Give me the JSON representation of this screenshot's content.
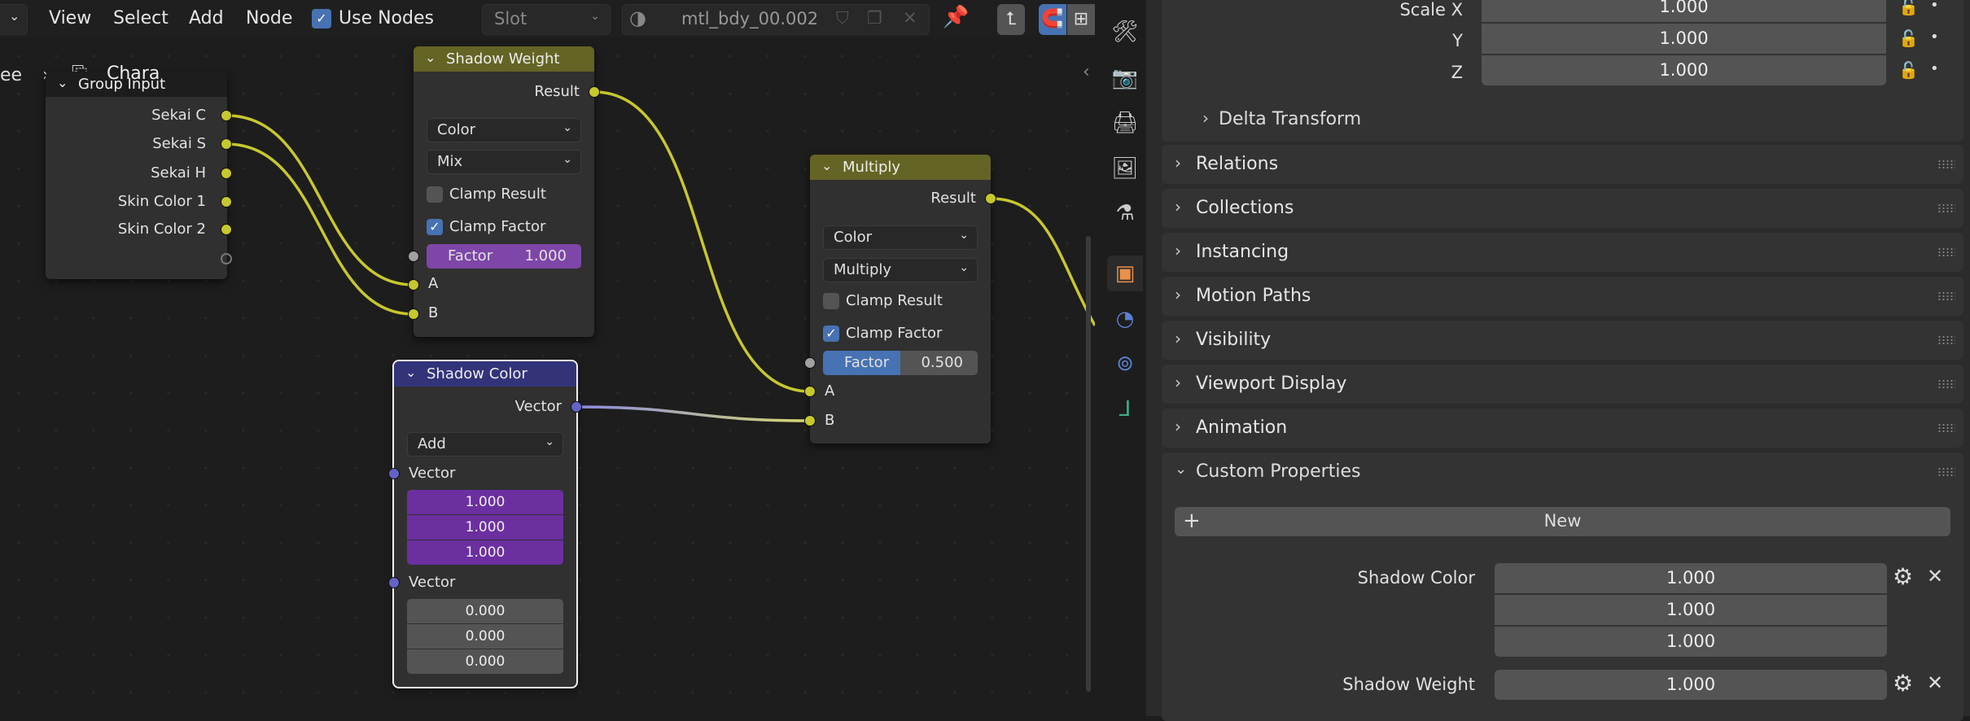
{
  "header": {
    "menus": [
      "View",
      "Select",
      "Add",
      "Node"
    ],
    "use_nodes_label": "Use Nodes",
    "use_nodes_checked": true,
    "slot_placeholder": "Slot",
    "material_name": "mtl_bdy_00.002"
  },
  "breadcrumb": {
    "prev": "ee",
    "item": "Chara"
  },
  "nodes": {
    "group_input": {
      "title": "Group Input",
      "outputs": [
        "Sekai C",
        "Sekai S",
        "Sekai H",
        "Skin Color 1",
        "Skin Color 2"
      ]
    },
    "shadow_weight": {
      "title": "Shadow Weight",
      "output": "Result",
      "data_type": "Color",
      "blend": "Mix",
      "clamp_result": "Clamp Result",
      "clamp_factor": "Clamp Factor",
      "factor_label": "Factor",
      "factor_value": "1.000",
      "inputs": [
        "A",
        "B"
      ],
      "color": "#646425"
    },
    "multiply": {
      "title": "Multiply",
      "output": "Result",
      "data_type": "Color",
      "blend": "Multiply",
      "clamp_result": "Clamp Result",
      "clamp_factor": "Clamp Factor",
      "factor_label": "Factor",
      "factor_value": "0.500",
      "factor_fraction": 0.5,
      "inputs": [
        "A",
        "B"
      ],
      "color": "#646425"
    },
    "shadow_color": {
      "title": "Shadow Color",
      "output": "Vector",
      "operation": "Add",
      "input1": "Vector",
      "values1": [
        "1.000",
        "1.000",
        "1.000"
      ],
      "input2": "Vector",
      "values2": [
        "0.000",
        "0.000",
        "0.000"
      ],
      "color": "#33337a"
    }
  },
  "properties": {
    "scale": [
      {
        "label": "Scale X",
        "value": "1.000"
      },
      {
        "label": "Y",
        "value": "1.000"
      },
      {
        "label": "Z",
        "value": "1.000"
      }
    ],
    "delta_transform": "Delta Transform",
    "panels": [
      "Relations",
      "Collections",
      "Instancing",
      "Motion Paths",
      "Visibility",
      "Viewport Display",
      "Animation"
    ],
    "custom_properties": {
      "title": "Custom Properties",
      "new_label": "New",
      "items": [
        {
          "label": "Shadow Color",
          "values": [
            "1.000",
            "1.000",
            "1.000"
          ]
        },
        {
          "label": "Shadow Weight",
          "values": [
            "1.000"
          ]
        }
      ]
    }
  },
  "tabs": [
    "tool-icon",
    "render-icon",
    "output-icon",
    "view-layer-icon",
    "scene-icon",
    "world-icon",
    "object-icon",
    "modifiers-icon",
    "particles-icon",
    "physics-icon"
  ]
}
